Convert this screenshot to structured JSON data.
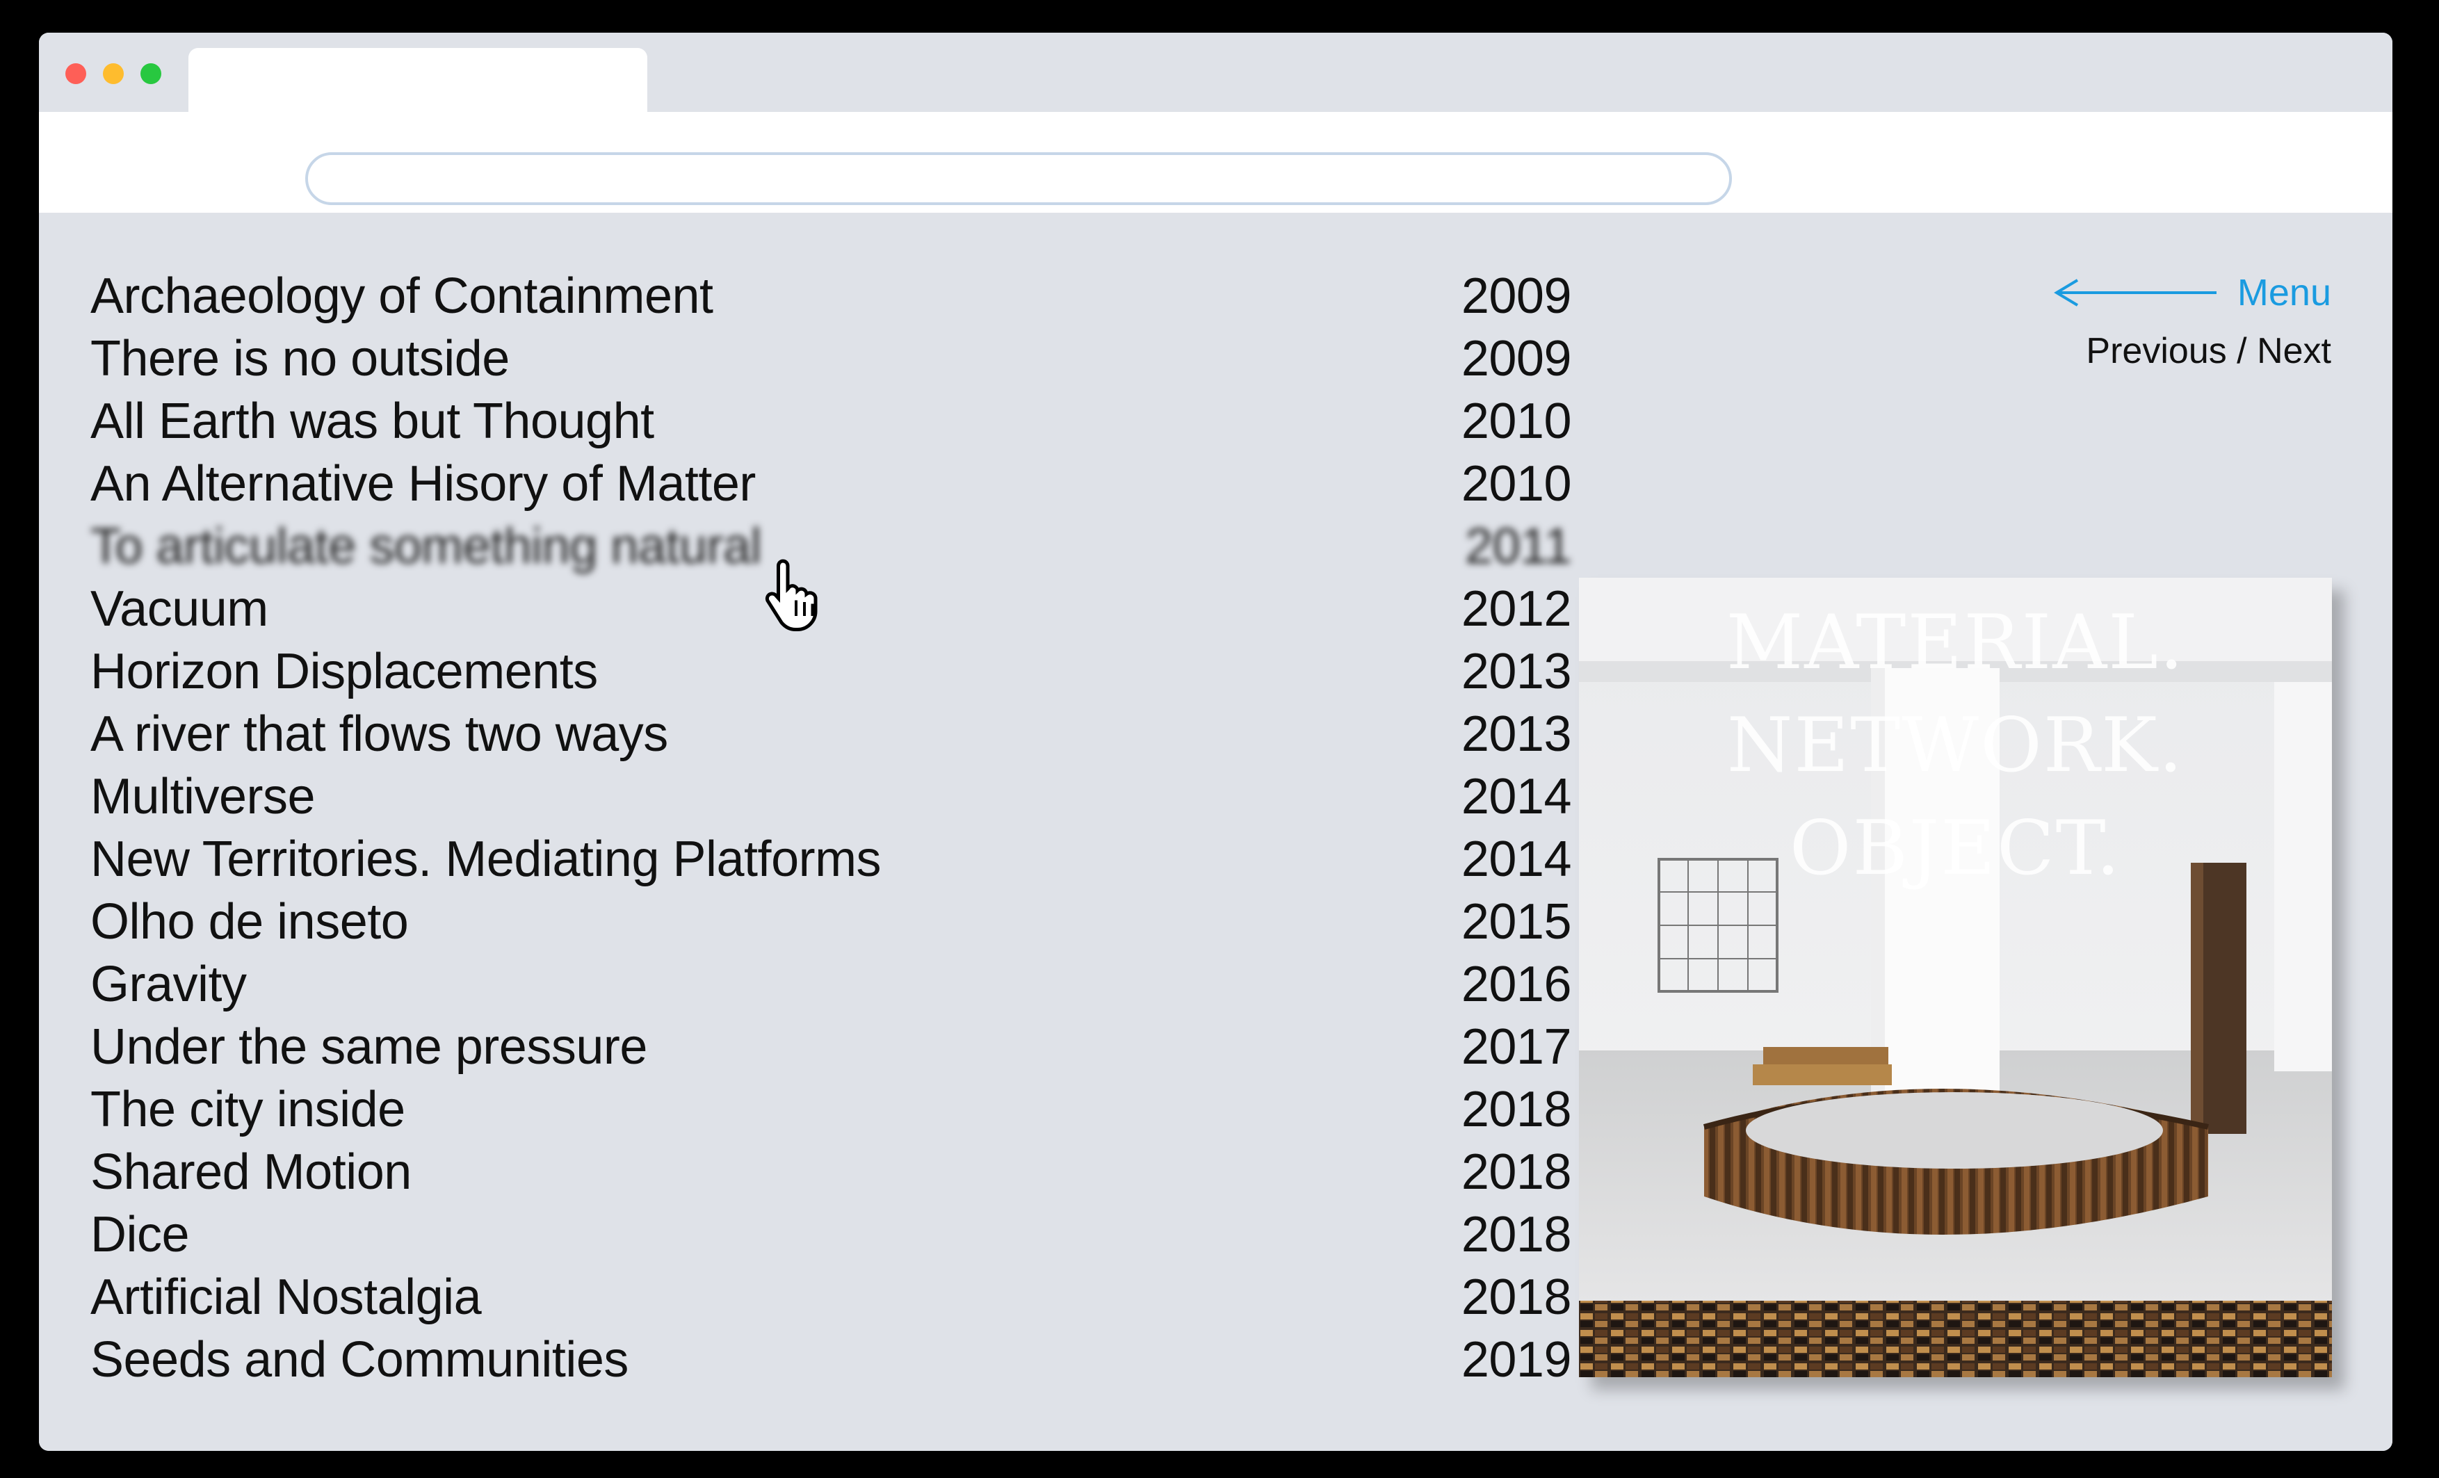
{
  "browser": {
    "tab_title": "",
    "url": ""
  },
  "nav": {
    "menu_label": "Menu",
    "prev_next_label": "Previous / Next"
  },
  "projects": [
    {
      "title": "Archaeology of Containment",
      "year": "2009"
    },
    {
      "title": "There is no outside",
      "year": "2009"
    },
    {
      "title": "All Earth was but Thought",
      "year": "2010"
    },
    {
      "title": "An Alternative Hisory of Matter",
      "year": "2010"
    },
    {
      "title": "To articulate something natural",
      "year": "2011"
    },
    {
      "title": "Vacuum",
      "year": "2012"
    },
    {
      "title": "Horizon Displacements",
      "year": "2013"
    },
    {
      "title": "A river that flows two ways",
      "year": "2013"
    },
    {
      "title": "Multiverse",
      "year": "2014"
    },
    {
      "title": "New Territories. Mediating Platforms",
      "year": "2014"
    },
    {
      "title": "Olho de inseto",
      "year": "2015"
    },
    {
      "title": "Gravity",
      "year": "2016"
    },
    {
      "title": "Under the same pressure",
      "year": "2017"
    },
    {
      "title": "The city inside",
      "year": "2018"
    },
    {
      "title": "Shared Motion",
      "year": "2018"
    },
    {
      "title": "Dice",
      "year": "2018"
    },
    {
      "title": "Artificial Nostalgia",
      "year": "2018"
    },
    {
      "title": "Seeds and Communities",
      "year": "2019"
    }
  ],
  "hovered_index": 4,
  "preview": {
    "line1": "MATERIAL.",
    "line2": "NETWORK.",
    "line3": "OBJECT."
  },
  "colors": {
    "accent": "#1a9be0",
    "background": "#dfe2e8"
  }
}
